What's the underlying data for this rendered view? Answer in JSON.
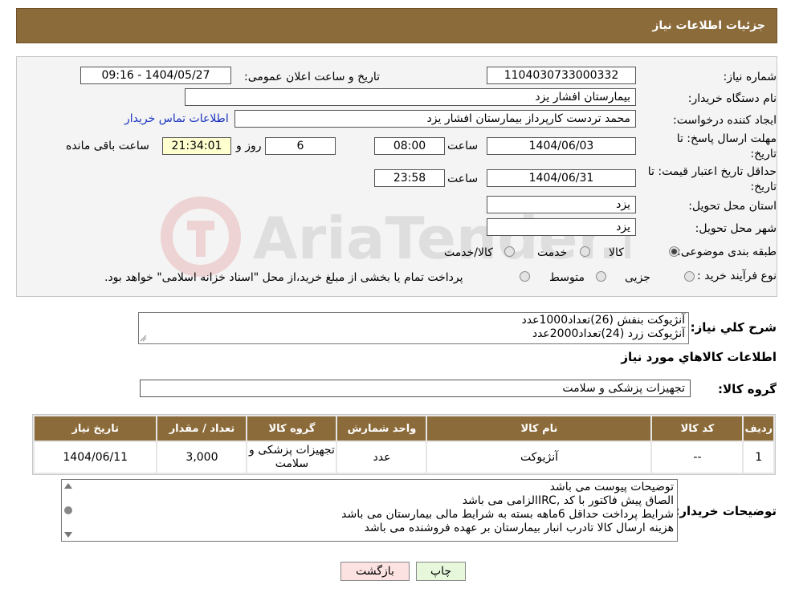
{
  "header": {
    "title": "جزئیات اطلاعات نیاز"
  },
  "form": {
    "need_number": {
      "label": "شماره نیاز:",
      "value": "1104030733000332"
    },
    "announce_datetime": {
      "label": "تاریخ و ساعت اعلان عمومی:",
      "value": "1404/05/27 - 09:16"
    },
    "buyer_org": {
      "label": "نام دستگاه خریدار:",
      "value": "بیمارستان افشار یزد"
    },
    "requester": {
      "label": "ایجاد کننده درخواست:",
      "value": "محمد تردست کارپرداز بیمارستان افشار یزد",
      "contact_link": "اطلاعات تماس خریدار"
    },
    "response_deadline": {
      "label_line1": "مهلت ارسال پاسخ: تا",
      "label_line2": "تاریخ:",
      "date": "1404/06/03",
      "time_label": "ساعت",
      "time": "08:00",
      "days": "6",
      "days_label": "روز و",
      "remaining_time": "21:34:01",
      "remaining_label": "ساعت باقی مانده"
    },
    "price_validity": {
      "label_line1": "حداقل تاریخ اعتبار قیمت: تا",
      "label_line2": "تاریخ:",
      "date": "1404/06/31",
      "time_label": "ساعت",
      "time": "23:58"
    },
    "province": {
      "label": "استان محل تحویل:",
      "value": "یزد"
    },
    "city": {
      "label": "شهر محل تحویل:",
      "value": "یزد"
    },
    "category": {
      "label": "طبقه بندی موضوعی:",
      "options": [
        "کالا",
        "خدمت",
        "کالا/خدمت"
      ]
    },
    "purchase_type": {
      "label": "نوع فرآیند خرید :",
      "options": [
        "جزیی",
        "متوسط"
      ],
      "note": "پرداخت تمام یا بخشی از مبلغ خرید،از محل \"اسناد خزانه اسلامی\" خواهد بود."
    }
  },
  "summary": {
    "label": "شرح کلي نياز:",
    "lines": [
      "آنژیوکت بنفش (26)تعداد1000عدد",
      "آنژیوکت زرد (24)تعداد2000عدد"
    ]
  },
  "items_section": {
    "title": "اطلاعات کالاهاي مورد نياز",
    "group_label": "گروه کالا:",
    "group_value": "تجهیزات پزشکی و سلامت"
  },
  "table": {
    "headers": [
      "رديف",
      "کد کالا",
      "نام کالا",
      "واحد شمارش",
      "گروه کالا",
      "تعداد / مقدار",
      "تاریخ نیاز"
    ],
    "rows": [
      [
        "1",
        "--",
        "آنژیوکت",
        "عدد",
        "تجهیزات پزشکی و سلامت",
        "3,000",
        "1404/06/11"
      ]
    ]
  },
  "buyer_notes": {
    "label": "توضیحات خریدار:",
    "lines": [
      "توضیحات پیوست می باشد",
      "الصاق پیش فاکتور با کد  ,IRCالزامی می باشد",
      "شرایط پرداخت حداقل 6ماهه بسته به شرایط مالی بیمارستان می باشد",
      "هزینه ارسال کالا تادرب انبار بیمارستان بر عهده فروشنده می باشد"
    ]
  },
  "buttons": {
    "print": "چاپ",
    "back": "بازگشت"
  },
  "colors": {
    "header_bg": "#8c6b3b",
    "link": "#1a33c0",
    "remaining_bg": "#ffffd0",
    "back_btn_bg": "#fde2e2",
    "print_btn_bg": "#e6f7dc"
  },
  "watermark": {
    "text": "AriaTender.neT"
  }
}
